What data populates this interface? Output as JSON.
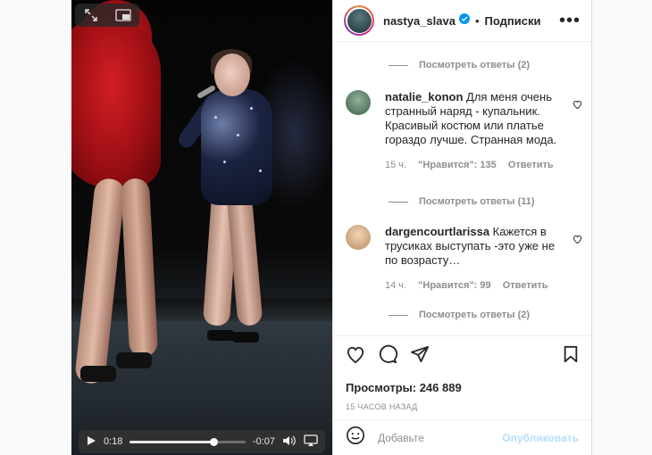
{
  "video": {
    "current_time": "0:18",
    "remaining_time": "-0:07",
    "progress_fraction": 0.72
  },
  "header": {
    "username": "nastya_slava",
    "separator": "•",
    "follow_label": "Подписки",
    "more_label": "•••"
  },
  "comments": {
    "view_replies_1": "Посмотреть ответы (2)",
    "items": [
      {
        "username": "natalie_konon",
        "text": "Для меня очень странный наряд - купальник. Красивый костюм или платье гораздо лучше. Странная мода.",
        "time": "15 ч.",
        "likes": "\"Нравится\": 135",
        "reply": "Ответить",
        "view_replies": "Посмотреть ответы (11)"
      },
      {
        "username": "dargencourtlarissa",
        "text": "Кажется в трусиках выступать -это уже не по возрасту…",
        "time": "14 ч.",
        "likes": "\"Нравится\": 99",
        "reply": "Ответить",
        "view_replies": "Посмотреть ответы (2)"
      }
    ]
  },
  "post": {
    "views": "Просмотры: 246 889",
    "time_ago": "15 ЧАСОВ НАЗАД"
  },
  "add_comment": {
    "placeholder": "Добавьте",
    "publish_label": "Опубликовать"
  },
  "icons": [
    "expand-icon",
    "picture-in-picture-icon",
    "play-icon",
    "volume-icon",
    "airplay-icon",
    "heart-icon",
    "comment-icon",
    "share-icon",
    "bookmark-icon",
    "emoji-icon",
    "verified-badge-icon"
  ],
  "colors": {
    "link_blue_disabled": "#b2dffc",
    "verified": "#0095f6",
    "meta_gray": "#8e8e8e"
  }
}
